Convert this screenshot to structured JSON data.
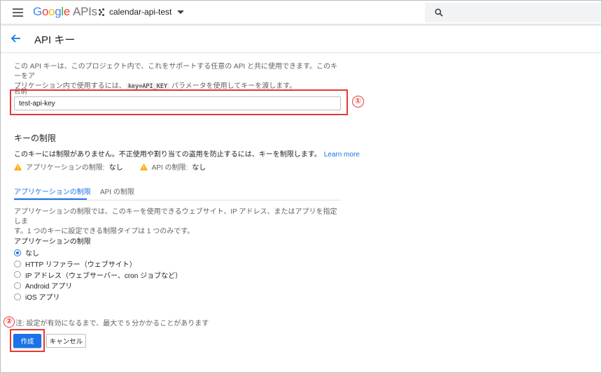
{
  "header": {
    "logo_letters": [
      "G",
      "o",
      "o",
      "g",
      "l",
      "e"
    ],
    "logo_suffix": "APIs",
    "project_name": "calendar-api-test"
  },
  "page": {
    "title": "API キー"
  },
  "intro": {
    "text_part1": "この API キーは、このプロジェクト内で、これをサポートする任意の API と共に使用できます。このキーをア",
    "text_part2": "プリケーション内で使用するには、",
    "code": "key=API_KEY",
    "text_part3": " パラメータを使用してキーを渡します。"
  },
  "name_field": {
    "label": "名前",
    "value": "test-api-key"
  },
  "key_restrictions": {
    "title": "キーの制限",
    "description": "このキーには制限がありません。不正使用や割り当ての盗用を防止するには、キーを制限します。",
    "learn_more": "Learn more",
    "warnings": [
      {
        "label": "アプリケーションの制限:",
        "value": "なし"
      },
      {
        "label": "API の制限:",
        "value": "なし"
      }
    ]
  },
  "tabs": [
    {
      "label": "アプリケーションの制限"
    },
    {
      "label": "API の制限"
    }
  ],
  "app_restriction": {
    "description_line1": "アプリケーションの制限では、このキーを使用できるウェブサイト、IP アドレス、またはアプリを指定しま",
    "description_line2": "す。1 つのキーに設定できる制限タイプは 1 つのみです。",
    "title": "アプリケーションの制限",
    "options": [
      {
        "label": "なし",
        "checked": true
      },
      {
        "label": "HTTP リファラー（ウェブサイト）",
        "checked": false
      },
      {
        "label": "IP アドレス（ウェブサーバー、cron ジョブなど）",
        "checked": false
      },
      {
        "label": "Android アプリ",
        "checked": false
      },
      {
        "label": "iOS アプリ",
        "checked": false
      }
    ]
  },
  "note": "注: 設定が有効になるまで、最大で 5 分かかることがあります",
  "buttons": {
    "create": "作成",
    "cancel": "キャンセル"
  },
  "annotations": {
    "marker1": "①",
    "marker2": "②",
    "color": "#e53935"
  },
  "colors": {
    "accent": "#1a73e8",
    "warning": "#f9ab00"
  }
}
